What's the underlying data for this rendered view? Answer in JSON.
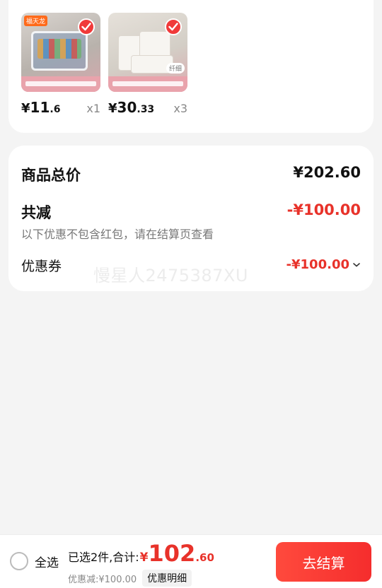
{
  "products": [
    {
      "price_symbol": "¥",
      "price_int": "11",
      "price_dec": ".6",
      "quantity": "x1",
      "tag": "福天龙",
      "image_icon": "storage-box-image"
    },
    {
      "price_symbol": "¥",
      "price_int": "30",
      "price_dec": ".33",
      "quantity": "x3",
      "tag": "纤细",
      "image_icon": "vacuum-bag-image"
    }
  ],
  "summary": {
    "total_label": "商品总价",
    "total_value": "¥202.60",
    "reduce_label": "共减",
    "reduce_value": "-¥100.00",
    "reduce_note": "以下优惠不包含红包，请在结算页查看",
    "coupon_label": "优惠券",
    "coupon_value": "-¥100.00"
  },
  "watermark": "慢星人2475387XU",
  "bottom_bar": {
    "select_all_label": "全选",
    "selected_text": "已选2件,合计:",
    "total_symbol": "¥",
    "total_int": "102",
    "total_dec": ".60",
    "discount_text": "优惠减:¥100.00",
    "detail_button": "优惠明细",
    "checkout_button": "去结算"
  },
  "colors": {
    "accent_red": "#e8322a",
    "checkout_gradient_start": "#ff4a3d",
    "background": "#f4f4f4"
  }
}
